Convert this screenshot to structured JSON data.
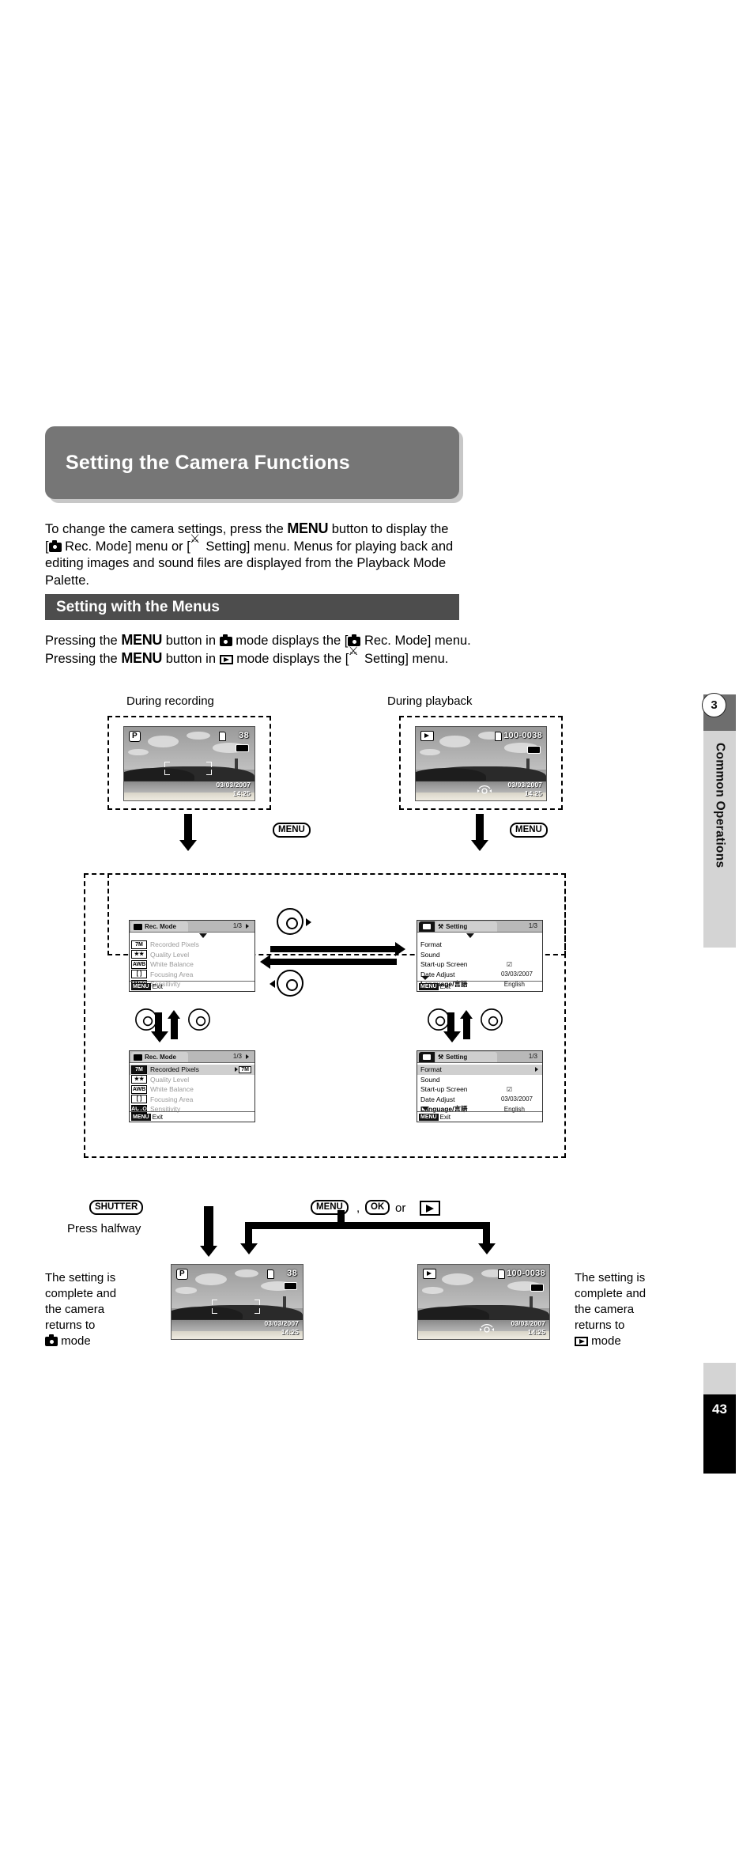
{
  "page": {
    "number": "43",
    "chapter_number": "3",
    "chapter_title": "Common Operations"
  },
  "title_banner": {
    "title": "Setting the Camera Functions"
  },
  "intro": {
    "line1_a": "To change the camera settings, press the ",
    "menu_word": "MENU",
    "line1_b": " button to display the",
    "line2_a": "[",
    "line2_b": " Rec. Mode] menu or [",
    "line2_c": " Setting] menu. Menus for playing back and",
    "line3": "editing images and sound files are displayed from the Playback Mode Palette."
  },
  "section": {
    "header": "Setting with the Menus"
  },
  "sub": {
    "line1_a": "Pressing the ",
    "line1_b": " button in ",
    "line1_c": " mode displays the [",
    "line1_d": " Rec. Mode] menu.",
    "line2_a": "Pressing the ",
    "line2_b": " button in ",
    "line2_c": " mode displays the [",
    "line2_d": " Setting] menu."
  },
  "flow": {
    "label_recording": "During recording",
    "label_playback": "During playback",
    "btn_menu": "MENU",
    "btn_menu2": "MENU",
    "btn_shutter": "SHUTTER",
    "press_halfway": "Press halfway",
    "btn_menu3": "MENU",
    "comma": ",",
    "btn_ok": "OK",
    "or_word": "or"
  },
  "cam_rec": {
    "mode_badge": "P",
    "shots_remaining": "38",
    "date": "03/03/2007",
    "time": "14:25"
  },
  "cam_play": {
    "file_number": "100-0038",
    "date": "03/03/2007",
    "time": "14:25"
  },
  "rec_menu": {
    "tab_title": "Rec. Mode",
    "page_indicator": "1/3",
    "footer_badge": "MENU",
    "footer_label": "Exit",
    "rows": [
      {
        "icon": "7M",
        "label": "Recorded Pixels",
        "value": ""
      },
      {
        "icon": "★★",
        "label": "Quality Level",
        "value": ""
      },
      {
        "icon": "AWB",
        "label": "White Balance",
        "value": ""
      },
      {
        "icon": "[  ]",
        "label": "Focusing Area",
        "value": ""
      },
      {
        "icon": "AUTO",
        "label": "Sensitivity",
        "value": ""
      }
    ]
  },
  "rec_menu_selected": {
    "tab_title": "Rec. Mode",
    "page_indicator": "1/3",
    "footer_badge": "MENU",
    "footer_label": "Exit",
    "selected_value": "7M",
    "rows": [
      {
        "icon": "7M",
        "label": "Recorded Pixels",
        "value": "7M"
      },
      {
        "icon": "★★",
        "label": "Quality Level",
        "value": ""
      },
      {
        "icon": "AWB",
        "label": "White Balance",
        "value": ""
      },
      {
        "icon": "[  ]",
        "label": "Focusing Area",
        "value": ""
      },
      {
        "icon": "AUTO",
        "label": "Sensitivity",
        "value": ""
      }
    ]
  },
  "set_menu": {
    "tab_title": "Setting",
    "page_indicator": "1/3",
    "footer_badge": "MENU",
    "footer_label": "Exit",
    "rows": [
      {
        "label": "Format",
        "value": ""
      },
      {
        "label": "Sound",
        "value": ""
      },
      {
        "label": "Start-up Screen",
        "value": "☑"
      },
      {
        "label": "Date Adjust",
        "value": "03/03/2007"
      },
      {
        "label": "Language/言語",
        "value": "English"
      }
    ]
  },
  "set_menu_selected": {
    "tab_title": "Setting",
    "page_indicator": "1/3",
    "footer_badge": "MENU",
    "footer_label": "Exit",
    "rows": [
      {
        "label": "Format",
        "value": ""
      },
      {
        "label": "Sound",
        "value": ""
      },
      {
        "label": "Start-up Screen",
        "value": "☑"
      },
      {
        "label": "Date Adjust",
        "value": "03/03/2007"
      },
      {
        "label": "Language/言語",
        "value": "English"
      }
    ]
  },
  "captions": {
    "left_l1": "The setting is",
    "left_l2": "complete and",
    "left_l3": "the camera",
    "left_l4": "returns to",
    "left_l5": " mode",
    "right_l1": "The setting is",
    "right_l2": "complete and",
    "right_l3": "the camera",
    "right_l4": "returns to",
    "right_l5": " mode"
  },
  "colors": {
    "banner_gray": "#767676",
    "section_gray": "#4d4d4d",
    "tab_gray": "#d4d4d4",
    "tab_dark": "#6e6e6e"
  }
}
